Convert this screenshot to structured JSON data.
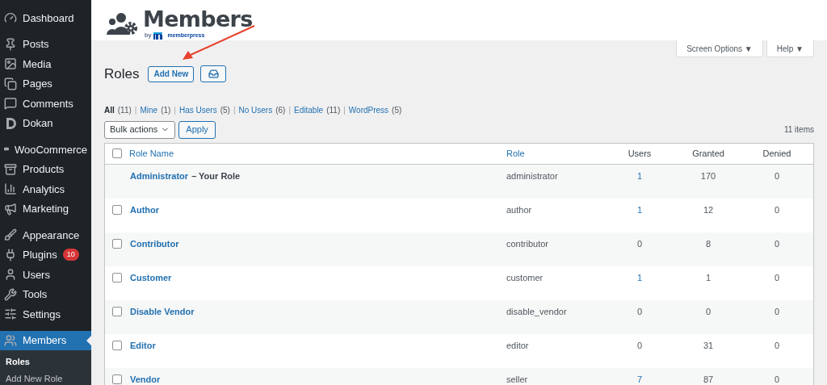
{
  "sidebar": {
    "groups": [
      [
        {
          "label": "Dashboard",
          "selected": false
        }
      ],
      [
        {
          "label": "Posts",
          "selected": false
        },
        {
          "label": "Media",
          "selected": false
        },
        {
          "label": "Pages",
          "selected": false
        },
        {
          "label": "Comments",
          "selected": false
        },
        {
          "label": "Dokan",
          "selected": false
        }
      ],
      [
        {
          "label": "WooCommerce",
          "selected": false
        },
        {
          "label": "Products",
          "selected": false
        },
        {
          "label": "Analytics",
          "selected": false
        },
        {
          "label": "Marketing",
          "selected": false
        }
      ],
      [
        {
          "label": "Appearance",
          "selected": false
        },
        {
          "label": "Plugins",
          "selected": false,
          "badge": "10"
        },
        {
          "label": "Users",
          "selected": false
        },
        {
          "label": "Tools",
          "selected": false
        },
        {
          "label": "Settings",
          "selected": false
        }
      ],
      [
        {
          "label": "Members",
          "selected": true,
          "submenu": [
            {
              "label": "Roles",
              "selected": true
            },
            {
              "label": "Add New Role",
              "selected": false
            }
          ]
        }
      ]
    ]
  },
  "logo": {
    "title": "Members",
    "by": "by",
    "brand": "memberpress"
  },
  "top_buttons": [
    "Screen Options ▼",
    "Help ▼"
  ],
  "heading": "Roles",
  "add_new": "Add New",
  "filter_separator": "|",
  "filters": [
    {
      "label": "All",
      "count": "(11)",
      "selected": true
    },
    {
      "label": "Mine",
      "count": "(1)",
      "selected": false
    },
    {
      "label": "Has Users",
      "count": "(5)",
      "selected": false
    },
    {
      "label": "No Users",
      "count": "(6)",
      "selected": false
    },
    {
      "label": "Editable",
      "count": "(11)",
      "selected": false
    },
    {
      "label": "WordPress",
      "count": "(5)",
      "selected": false
    }
  ],
  "bulk_actions": "Bulk actions",
  "apply": "Apply",
  "items_count": "11 items",
  "table": {
    "columns": [
      "Role Name",
      "Role",
      "Users",
      "Granted",
      "Denied"
    ],
    "select_all_checked": false,
    "rows": [
      {
        "name": "Administrator",
        "note": "– Your Role",
        "role": "administrator",
        "users": "1",
        "users_link": true,
        "granted": "170",
        "denied": "0"
      },
      {
        "name": "Author",
        "checked": false,
        "role": "author",
        "users": "1",
        "users_link": true,
        "granted": "12",
        "denied": "0"
      },
      {
        "name": "Contributor",
        "checked": false,
        "role": "contributor",
        "users": "0",
        "users_link": false,
        "granted": "8",
        "denied": "0"
      },
      {
        "name": "Customer",
        "checked": false,
        "role": "customer",
        "users": "1",
        "users_link": true,
        "granted": "1",
        "denied": "0"
      },
      {
        "name": "Disable Vendor",
        "checked": false,
        "role": "disable_vendor",
        "users": "0",
        "users_link": false,
        "granted": "0",
        "denied": "0"
      },
      {
        "name": "Editor",
        "checked": false,
        "role": "editor",
        "users": "0",
        "users_link": false,
        "granted": "31",
        "denied": "0"
      },
      {
        "name": "Vendor",
        "checked": false,
        "role": "seller",
        "users": "7",
        "users_link": true,
        "granted": "87",
        "denied": "0"
      }
    ]
  }
}
